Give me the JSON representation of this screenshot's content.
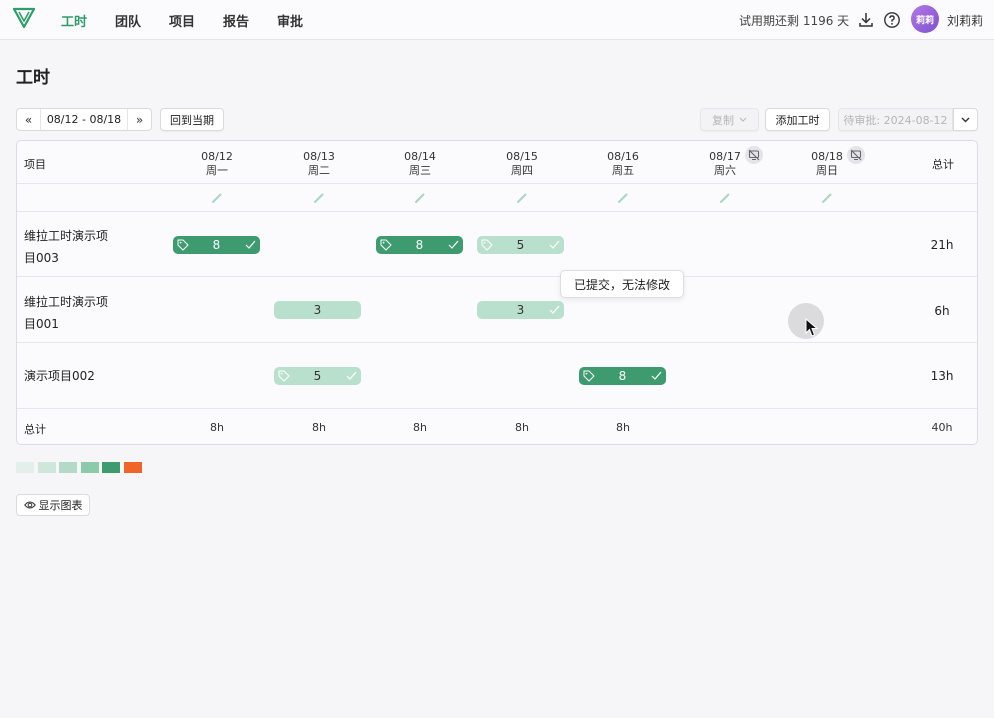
{
  "nav": {
    "items": [
      {
        "label": "工时",
        "active": true
      },
      {
        "label": "团队",
        "active": false
      },
      {
        "label": "项目",
        "active": false
      },
      {
        "label": "报告",
        "active": false
      },
      {
        "label": "审批",
        "active": false
      }
    ],
    "trial_text": "试用期还剩 1196 天",
    "user_name": "刘莉莉",
    "avatar_text": "莉莉",
    "accent": "#2e9d6a"
  },
  "page": {
    "title": "工时"
  },
  "toolbar": {
    "date_range": "08/12 - 08/18",
    "back_to_current": "回到当期",
    "copy": "复制",
    "add_hours": "添加工时",
    "pending_approval": "待审批: 2024-08-12"
  },
  "table": {
    "project_header": "项目",
    "total_header": "总计",
    "days": [
      {
        "date": "08/12",
        "weekday": "周一",
        "off": false
      },
      {
        "date": "08/13",
        "weekday": "周二",
        "off": false
      },
      {
        "date": "08/14",
        "weekday": "周三",
        "off": false
      },
      {
        "date": "08/15",
        "weekday": "周四",
        "off": false
      },
      {
        "date": "08/16",
        "weekday": "周五",
        "off": false
      },
      {
        "date": "08/17",
        "weekday": "周六",
        "off": true
      },
      {
        "date": "08/18",
        "weekday": "周日",
        "off": true
      }
    ],
    "rows": [
      {
        "name": "维拉工时演示项目003",
        "total": "21h",
        "entries": [
          {
            "day": 0,
            "hours": "8",
            "style": "dark"
          },
          {
            "day": 2,
            "hours": "8",
            "style": "dark"
          },
          {
            "day": 3,
            "hours": "5",
            "style": "light"
          }
        ]
      },
      {
        "name": "维拉工时演示项目001",
        "total": "6h",
        "entries": [
          {
            "day": 1,
            "hours": "3",
            "style": "light"
          },
          {
            "day": 3,
            "hours": "3",
            "style": "light"
          }
        ]
      },
      {
        "name": "演示项目002",
        "total": "13h",
        "entries": [
          {
            "day": 1,
            "hours": "5",
            "style": "light"
          },
          {
            "day": 4,
            "hours": "8",
            "style": "dark"
          }
        ]
      }
    ],
    "summary_label": "总计",
    "day_totals": [
      "8h",
      "8h",
      "8h",
      "8h",
      "8h",
      "",
      ""
    ],
    "grand_total": "40h"
  },
  "tooltip": "已提交，无法修改",
  "legend_colors": [
    "#e3efea",
    "#cfe6db",
    "#b4d9c6",
    "#8ccaa9",
    "#3d9b6f",
    "#f0642a"
  ],
  "show_chart": "显示图表",
  "colors": {
    "chip_dark": "#3d9b6f",
    "chip_light": "#b9e0cd"
  }
}
